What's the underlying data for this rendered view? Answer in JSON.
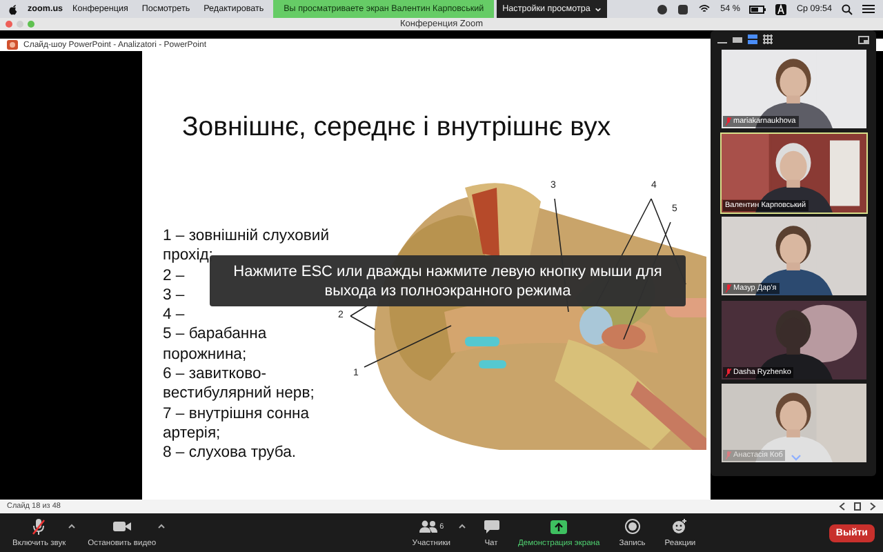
{
  "menubar": {
    "app": "zoom.us",
    "menus": [
      "Конференция",
      "Посмотреть",
      "Редактировать"
    ],
    "share_banner": "Вы просматриваете экран Валентин Карповський",
    "view_options": "Настройки просмотра",
    "battery": "54 %",
    "clock": "Ср 09:54"
  },
  "window": {
    "title": "Конференция Zoom"
  },
  "presentation": {
    "title": "Слайд-шоу PowerPoint  -  Analizatori  -  PowerPoint",
    "slide": {
      "title": "Зовнішнє, середнє і внутрішнє вух",
      "items": [
        "1 – зовнішній слуховий прохід;",
        "2 –",
        "3 –",
        "4 –",
        "5 – барабанна порожнина;",
        "6 – завитково-вестибулярний нерв;",
        "7 – внутрішня сонна артерія;",
        "8 – слухова труба."
      ],
      "diagram_labels": [
        "1",
        "2",
        "3",
        "4",
        "5"
      ]
    },
    "status": "Слайд 18 из 48"
  },
  "fullscreen_hint": "Нажмите ESC или дважды нажмите левую кнопку мыши для выхода из полноэкранного режима",
  "gallery": {
    "participants": [
      {
        "name": "mariakarnaukhova",
        "muted": true,
        "speaking": false
      },
      {
        "name": "Валентин Карповський",
        "muted": false,
        "speaking": true
      },
      {
        "name": "Мазур Дар'я",
        "muted": true,
        "speaking": false
      },
      {
        "name": "Dasha Ryzhenko",
        "muted": true,
        "speaking": false
      },
      {
        "name": "Анастасія Коб",
        "muted": true,
        "speaking": false
      }
    ]
  },
  "toolbar": {
    "buttons": [
      {
        "kind": "mic",
        "label": "Включить звук",
        "muted": true
      },
      {
        "kind": "video",
        "label": "Остановить видео"
      },
      {
        "kind": "participants",
        "label": "Участники",
        "count": "6"
      },
      {
        "kind": "chat",
        "label": "Чат"
      },
      {
        "kind": "share",
        "label": "Демонстрация экрана"
      },
      {
        "kind": "record",
        "label": "Запись"
      },
      {
        "kind": "reactions",
        "label": "Реакции"
      }
    ],
    "leave": "Выйти"
  }
}
